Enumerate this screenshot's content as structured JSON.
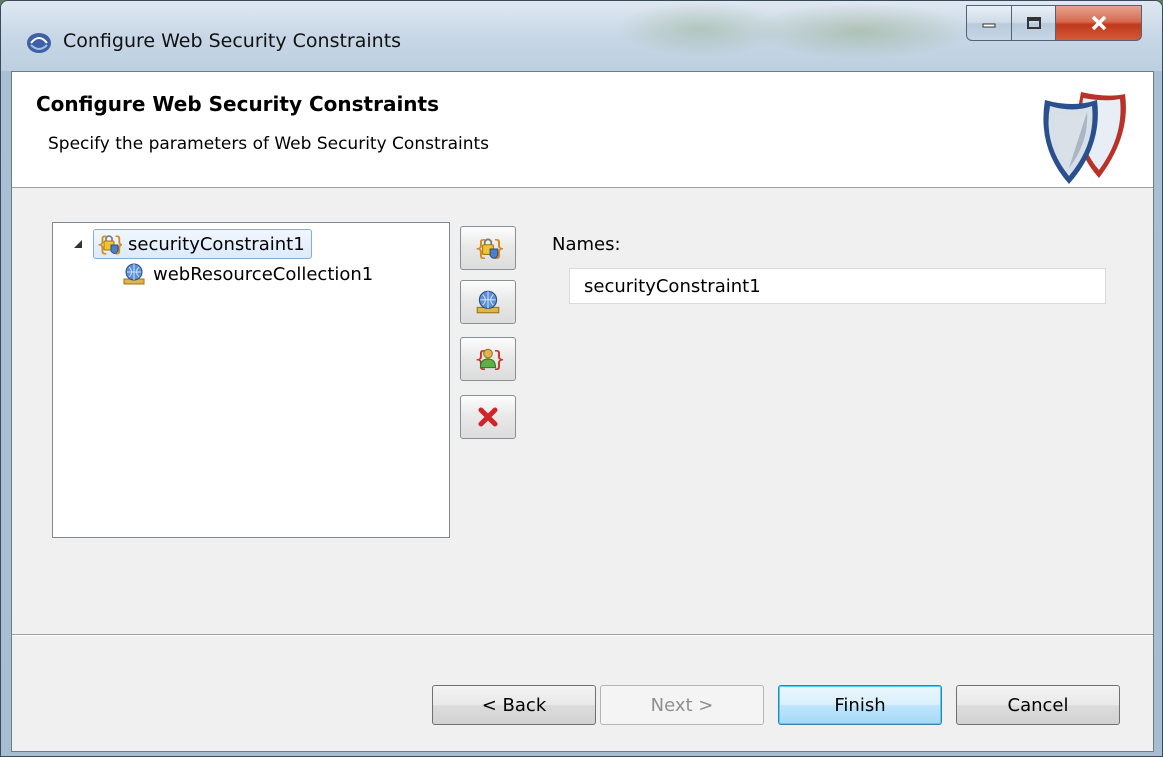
{
  "window": {
    "title": "Configure Web Security Constraints"
  },
  "header": {
    "title": "Configure Web Security Constraints",
    "subtitle": "Specify the parameters of Web Security Constraints"
  },
  "tree": {
    "items": [
      {
        "label": "securityConstraint1",
        "icon": "security-constraint-icon",
        "selected": true,
        "expanded": true
      },
      {
        "label": "webResourceCollection1",
        "icon": "web-resource-collection-icon",
        "selected": false
      }
    ]
  },
  "tools": [
    {
      "icon": "add-security-constraint-icon"
    },
    {
      "icon": "add-web-resource-collection-icon"
    },
    {
      "icon": "add-auth-constraint-icon"
    },
    {
      "icon": "delete-icon"
    }
  ],
  "form": {
    "names_label": "Names:",
    "names_value": "securityConstraint1"
  },
  "buttons": {
    "back": "< Back",
    "next": "Next >",
    "finish": "Finish",
    "cancel": "Cancel"
  },
  "colors": {
    "selection_border": "#84acdd",
    "default_button_border": "#3c7fb1",
    "close_button": "#c0391b"
  }
}
